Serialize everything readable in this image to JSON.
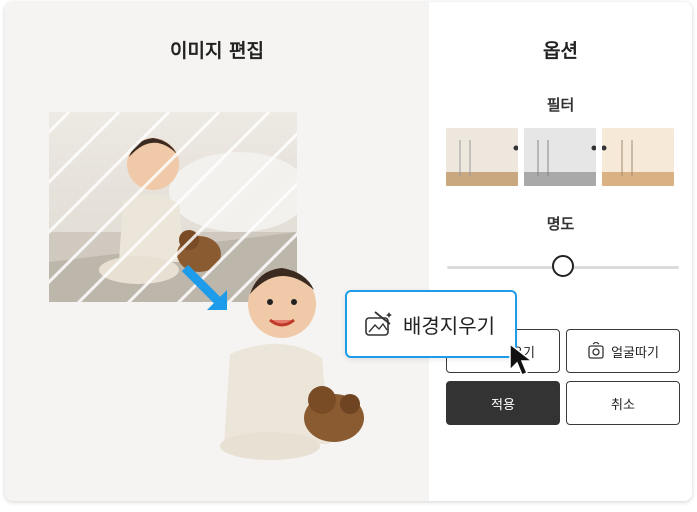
{
  "left_panel": {
    "title": "이미지 편집"
  },
  "right_panel": {
    "title": "옵션",
    "filter_label": "필터",
    "brightness_label": "명도",
    "brightness_value": 0.5
  },
  "buttons": {
    "remove_bg_partial": "우기",
    "face_cutout": "얼굴따기",
    "apply": "적용",
    "cancel": "취소"
  },
  "tooltip": {
    "label": "배경지우기"
  },
  "colors": {
    "accent": "#1e9be9",
    "dark_button": "#333333",
    "left_bg": "#f5f4f2"
  },
  "icons": {
    "remove_bg": "image-wand-icon",
    "face": "face-crop-icon",
    "cursor": "mouse-pointer-icon"
  }
}
